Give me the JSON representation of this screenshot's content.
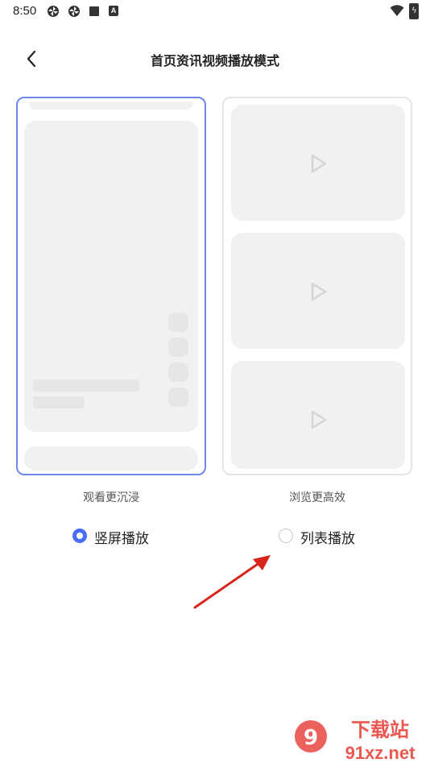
{
  "status_bar": {
    "time": "8:50",
    "icons": [
      "pinwheel-icon",
      "pinwheel-icon",
      "square-icon",
      "a-icon",
      "wifi-icon",
      "battery-icon"
    ],
    "a_glyph": "A"
  },
  "header": {
    "title": "首页资讯视频播放模式",
    "back_icon": "chevron-left-icon"
  },
  "options": [
    {
      "caption": "观看更沉浸",
      "label": "竖屏播放",
      "selected": true
    },
    {
      "caption": "浏览更高效",
      "label": "列表播放",
      "selected": false
    }
  ],
  "colors": {
    "accent": "#4a6cf7",
    "selected_card_border": "#6f87f0",
    "annotation_arrow": "#d9261c"
  },
  "watermark": {
    "line1": "下载站",
    "line2": "91xz.net"
  }
}
